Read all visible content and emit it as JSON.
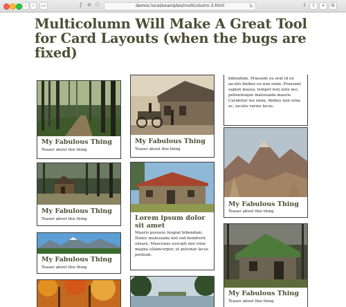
{
  "browser": {
    "url": "demos.local/examples/multicolumn-3.html",
    "reload_glyph": "↻",
    "back_glyph": "‹",
    "forward_glyph": "›",
    "sidebar_glyph": "▭",
    "share_glyph": "⇧",
    "tabs_glyph": "⧉",
    "download_glyph": "↓",
    "plus_glyph": "+",
    "ext_glyph": "ƒ",
    "shield_glyph": "⊘",
    "info_glyph": "ⓘ"
  },
  "page": {
    "title": "Multicolumn Will Make A Great Tool for Card Layouts (when the bugs are fixed)"
  },
  "cards": {
    "c1": {
      "title": "My Fabulous Thing",
      "text": "Teaser about this thing"
    },
    "c2": {
      "title": "My Fabulous Thing",
      "text": "Teaser about this thing"
    },
    "c3": {
      "title": "My Fabulous Thing",
      "text": "Teaser about this thing"
    },
    "c5": {
      "title": "My Fabulous Thing",
      "text": "Teaser about this thing"
    },
    "c6": {
      "title": "Lorem ipsum dolor sit amet",
      "text": "Mauris posuere feugiat bibendum. Donec malesuada nisl sed hendrerit ornare. Maecenas suscipit nisi vitae magna ullamcorper, ut pulvinar lacus pretium."
    },
    "c8": {
      "text": "bibendum. Praesent eu erat id ex iaculis finibus eu non enim. Praesent sapien massa, tempor non ante nec, pellentesque malesuada mauris. Curabitur leo enim, finibus non urna ac, iaculis varius lacus."
    },
    "c9": {
      "title": "My Fabulous Thing",
      "text": "Teaser about this thing"
    },
    "c10": {
      "title": "My Fabulous Thing",
      "text": "Teaser about this thing"
    }
  }
}
